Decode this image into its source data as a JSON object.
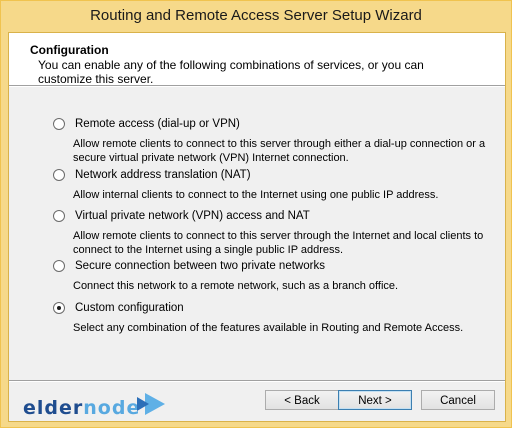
{
  "window": {
    "title": "Routing and Remote Access Server Setup Wizard"
  },
  "header": {
    "title": "Configuration",
    "subtitle": "You can enable any of the following combinations of services, or you can customize this server."
  },
  "options": [
    {
      "label": "Remote access (dial-up or VPN)",
      "description": "Allow remote clients to connect to this server through either a dial-up connection or a secure virtual private network (VPN) Internet connection.",
      "selected": false
    },
    {
      "label": "Network address translation (NAT)",
      "description": "Allow internal clients to connect to the Internet using one public IP address.",
      "selected": false
    },
    {
      "label": "Virtual private network (VPN) access and NAT",
      "description": "Allow remote clients to connect to this server through the Internet and local clients to connect to the Internet using a single public IP address.",
      "selected": false
    },
    {
      "label": "Secure connection between two private networks",
      "description": "Connect this network to a remote network, such as a branch office.",
      "selected": false
    },
    {
      "label": "Custom configuration",
      "description": "Select any combination of the features available in Routing and Remote Access.",
      "selected": true
    }
  ],
  "brand": {
    "part1": "elder",
    "part2": "node"
  },
  "buttons": {
    "back": "< Back",
    "next": "Next >",
    "cancel": "Cancel"
  }
}
